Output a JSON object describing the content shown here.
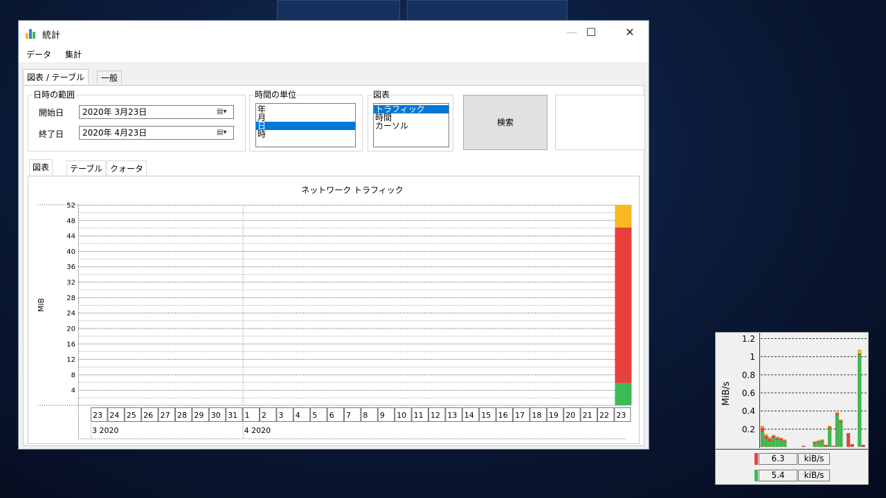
{
  "window": {
    "title": "統計",
    "minimize_symbol": "—",
    "maximize_symbol": "☐",
    "close_symbol": "✕"
  },
  "menu": {
    "items": [
      "データ",
      "集計"
    ]
  },
  "tabs": {
    "items": [
      "図表 / テーブル",
      "一般"
    ],
    "active": 0
  },
  "date_range": {
    "group_label": "日時の範囲",
    "start_label": "開始日",
    "start_value": "2020年  3月23日",
    "end_label": "終了日",
    "end_value": "2020年  4月23日"
  },
  "time_unit": {
    "group_label": "時間の単位",
    "options": [
      "年",
      "月",
      "日",
      "時"
    ],
    "selected": "日"
  },
  "chart_select": {
    "group_label": "図表",
    "options": [
      "トラフィック",
      "時間",
      "カーソル"
    ],
    "selected": "トラフィック"
  },
  "search_button": "検索",
  "inner_tabs": {
    "items": [
      "図表",
      "テーブル",
      "クォータ"
    ],
    "active": 0
  },
  "icons": {
    "app": "bar-chart-icon",
    "date_dropdown": "calendar-dropdown-icon"
  },
  "colors": {
    "green": "#3cba54",
    "red": "#e8413c",
    "orange": "#f9b824",
    "selection": "#0078d7"
  },
  "chart_data": {
    "type": "bar",
    "title": "ネットワーク トラフィック",
    "ylabel": "MiB",
    "ylim": [
      0,
      52
    ],
    "yticks": [
      "4",
      "8",
      "12",
      "16",
      "20",
      "24",
      "28",
      "32",
      "36",
      "40",
      "44",
      "48",
      "52"
    ],
    "categories": [
      "23",
      "24",
      "25",
      "26",
      "27",
      "28",
      "29",
      "30",
      "31",
      "1",
      "2",
      "3",
      "4",
      "5",
      "6",
      "7",
      "8",
      "9",
      "10",
      "11",
      "12",
      "13",
      "14",
      "15",
      "16",
      "17",
      "18",
      "19",
      "20",
      "21",
      "22",
      "23"
    ],
    "month_groups": [
      {
        "label": "3 2020",
        "count": 9
      },
      {
        "label": "4 2020",
        "count": 23
      }
    ],
    "stacked": true,
    "series": [
      {
        "color": "#3cba54",
        "values": [
          0,
          0,
          0,
          0,
          0,
          0,
          0,
          0,
          0,
          0,
          0,
          0,
          0,
          0,
          0,
          0,
          0,
          0,
          0,
          0,
          0,
          0,
          0,
          0,
          0,
          0,
          0,
          0,
          0,
          0,
          0,
          5.8
        ]
      },
      {
        "color": "#e8413c",
        "values": [
          0,
          0,
          0,
          0,
          0,
          0,
          0,
          0,
          0,
          0,
          0,
          0,
          0,
          0,
          0,
          0,
          0,
          0,
          0,
          0,
          0,
          0,
          0,
          0,
          0,
          0,
          0,
          0,
          0,
          0,
          0,
          40.3
        ]
      },
      {
        "color": "#f9b824",
        "values": [
          0,
          0,
          0,
          0,
          0,
          0,
          0,
          0,
          0,
          0,
          0,
          0,
          0,
          0,
          0,
          0,
          0,
          0,
          0,
          0,
          0,
          0,
          0,
          0,
          0,
          0,
          0,
          0,
          0,
          0,
          0,
          5.9
        ]
      }
    ],
    "grid": true
  },
  "gadget": {
    "ylabel": "MiB/s",
    "yticks": [
      "0.2",
      "0.4",
      "0.6",
      "0.8",
      "1",
      "1.2"
    ],
    "ymax": 1.2,
    "bars": [
      {
        "g": 0.17,
        "r": 0.04,
        "o": 0.02
      },
      {
        "g": 0.09,
        "r": 0.03,
        "o": 0.02
      },
      {
        "g": 0.06,
        "r": 0.03,
        "o": 0.02
      },
      {
        "g": 0.1,
        "r": 0.02,
        "o": 0.01
      },
      {
        "g": 0.08,
        "r": 0.02,
        "o": 0.01
      },
      {
        "g": 0.07,
        "r": 0.02,
        "o": 0.01
      },
      {
        "g": 0.06,
        "r": 0.01,
        "o": 0.01
      },
      {
        "g": 0,
        "r": 0,
        "o": 0
      },
      {
        "g": 0,
        "r": 0,
        "o": 0
      },
      {
        "g": 0,
        "r": 0,
        "o": 0
      },
      {
        "g": 0,
        "r": 0,
        "o": 0
      },
      {
        "g": 0,
        "r": 0.01,
        "o": 0
      },
      {
        "g": 0,
        "r": 0,
        "o": 0
      },
      {
        "g": 0,
        "r": 0,
        "o": 0
      },
      {
        "g": 0.04,
        "r": 0.01,
        "o": 0.01
      },
      {
        "g": 0.05,
        "r": 0.01,
        "o": 0.01
      },
      {
        "g": 0.06,
        "r": 0.01,
        "o": 0.01
      },
      {
        "g": 0,
        "r": 0.02,
        "o": 0
      },
      {
        "g": 0.2,
        "r": 0.02,
        "o": 0.01
      },
      {
        "g": 0,
        "r": 0.01,
        "o": 0
      },
      {
        "g": 0.35,
        "r": 0.02,
        "o": 0.01
      },
      {
        "g": 0.27,
        "r": 0.02,
        "o": 0.01
      },
      {
        "g": 0,
        "r": 0,
        "o": 0
      },
      {
        "g": 0,
        "r": 0.15,
        "o": 0
      },
      {
        "g": 0,
        "r": 0.03,
        "o": 0
      },
      {
        "g": 0,
        "r": 0,
        "o": 0
      },
      {
        "g": 1.02,
        "r": 0.01,
        "o": 0.04
      },
      {
        "g": 0,
        "r": 0.02,
        "o": 0
      }
    ],
    "readouts": [
      {
        "color": "#e8413c",
        "value": "6.3",
        "unit": "kiB/s"
      },
      {
        "color": "#3cba54",
        "value": "5.4",
        "unit": "kiB/s"
      }
    ]
  }
}
